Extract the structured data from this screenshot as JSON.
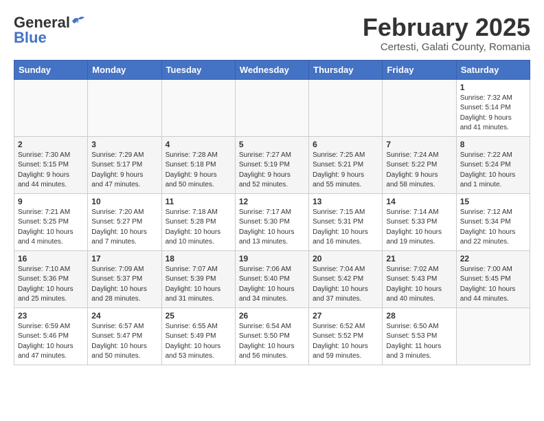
{
  "header": {
    "logo_general": "General",
    "logo_blue": "Blue",
    "title": "February 2025",
    "subtitle": "Certesti, Galati County, Romania"
  },
  "calendar": {
    "weekdays": [
      "Sunday",
      "Monday",
      "Tuesday",
      "Wednesday",
      "Thursday",
      "Friday",
      "Saturday"
    ],
    "rows": [
      [
        {
          "day": "",
          "info": ""
        },
        {
          "day": "",
          "info": ""
        },
        {
          "day": "",
          "info": ""
        },
        {
          "day": "",
          "info": ""
        },
        {
          "day": "",
          "info": ""
        },
        {
          "day": "",
          "info": ""
        },
        {
          "day": "1",
          "info": "Sunrise: 7:32 AM\nSunset: 5:14 PM\nDaylight: 9 hours\nand 41 minutes."
        }
      ],
      [
        {
          "day": "2",
          "info": "Sunrise: 7:30 AM\nSunset: 5:15 PM\nDaylight: 9 hours\nand 44 minutes."
        },
        {
          "day": "3",
          "info": "Sunrise: 7:29 AM\nSunset: 5:17 PM\nDaylight: 9 hours\nand 47 minutes."
        },
        {
          "day": "4",
          "info": "Sunrise: 7:28 AM\nSunset: 5:18 PM\nDaylight: 9 hours\nand 50 minutes."
        },
        {
          "day": "5",
          "info": "Sunrise: 7:27 AM\nSunset: 5:19 PM\nDaylight: 9 hours\nand 52 minutes."
        },
        {
          "day": "6",
          "info": "Sunrise: 7:25 AM\nSunset: 5:21 PM\nDaylight: 9 hours\nand 55 minutes."
        },
        {
          "day": "7",
          "info": "Sunrise: 7:24 AM\nSunset: 5:22 PM\nDaylight: 9 hours\nand 58 minutes."
        },
        {
          "day": "8",
          "info": "Sunrise: 7:22 AM\nSunset: 5:24 PM\nDaylight: 10 hours\nand 1 minute."
        }
      ],
      [
        {
          "day": "9",
          "info": "Sunrise: 7:21 AM\nSunset: 5:25 PM\nDaylight: 10 hours\nand 4 minutes."
        },
        {
          "day": "10",
          "info": "Sunrise: 7:20 AM\nSunset: 5:27 PM\nDaylight: 10 hours\nand 7 minutes."
        },
        {
          "day": "11",
          "info": "Sunrise: 7:18 AM\nSunset: 5:28 PM\nDaylight: 10 hours\nand 10 minutes."
        },
        {
          "day": "12",
          "info": "Sunrise: 7:17 AM\nSunset: 5:30 PM\nDaylight: 10 hours\nand 13 minutes."
        },
        {
          "day": "13",
          "info": "Sunrise: 7:15 AM\nSunset: 5:31 PM\nDaylight: 10 hours\nand 16 minutes."
        },
        {
          "day": "14",
          "info": "Sunrise: 7:14 AM\nSunset: 5:33 PM\nDaylight: 10 hours\nand 19 minutes."
        },
        {
          "day": "15",
          "info": "Sunrise: 7:12 AM\nSunset: 5:34 PM\nDaylight: 10 hours\nand 22 minutes."
        }
      ],
      [
        {
          "day": "16",
          "info": "Sunrise: 7:10 AM\nSunset: 5:36 PM\nDaylight: 10 hours\nand 25 minutes."
        },
        {
          "day": "17",
          "info": "Sunrise: 7:09 AM\nSunset: 5:37 PM\nDaylight: 10 hours\nand 28 minutes."
        },
        {
          "day": "18",
          "info": "Sunrise: 7:07 AM\nSunset: 5:39 PM\nDaylight: 10 hours\nand 31 minutes."
        },
        {
          "day": "19",
          "info": "Sunrise: 7:06 AM\nSunset: 5:40 PM\nDaylight: 10 hours\nand 34 minutes."
        },
        {
          "day": "20",
          "info": "Sunrise: 7:04 AM\nSunset: 5:42 PM\nDaylight: 10 hours\nand 37 minutes."
        },
        {
          "day": "21",
          "info": "Sunrise: 7:02 AM\nSunset: 5:43 PM\nDaylight: 10 hours\nand 40 minutes."
        },
        {
          "day": "22",
          "info": "Sunrise: 7:00 AM\nSunset: 5:45 PM\nDaylight: 10 hours\nand 44 minutes."
        }
      ],
      [
        {
          "day": "23",
          "info": "Sunrise: 6:59 AM\nSunset: 5:46 PM\nDaylight: 10 hours\nand 47 minutes."
        },
        {
          "day": "24",
          "info": "Sunrise: 6:57 AM\nSunset: 5:47 PM\nDaylight: 10 hours\nand 50 minutes."
        },
        {
          "day": "25",
          "info": "Sunrise: 6:55 AM\nSunset: 5:49 PM\nDaylight: 10 hours\nand 53 minutes."
        },
        {
          "day": "26",
          "info": "Sunrise: 6:54 AM\nSunset: 5:50 PM\nDaylight: 10 hours\nand 56 minutes."
        },
        {
          "day": "27",
          "info": "Sunrise: 6:52 AM\nSunset: 5:52 PM\nDaylight: 10 hours\nand 59 minutes."
        },
        {
          "day": "28",
          "info": "Sunrise: 6:50 AM\nSunset: 5:53 PM\nDaylight: 11 hours\nand 3 minutes."
        },
        {
          "day": "",
          "info": ""
        }
      ]
    ]
  }
}
